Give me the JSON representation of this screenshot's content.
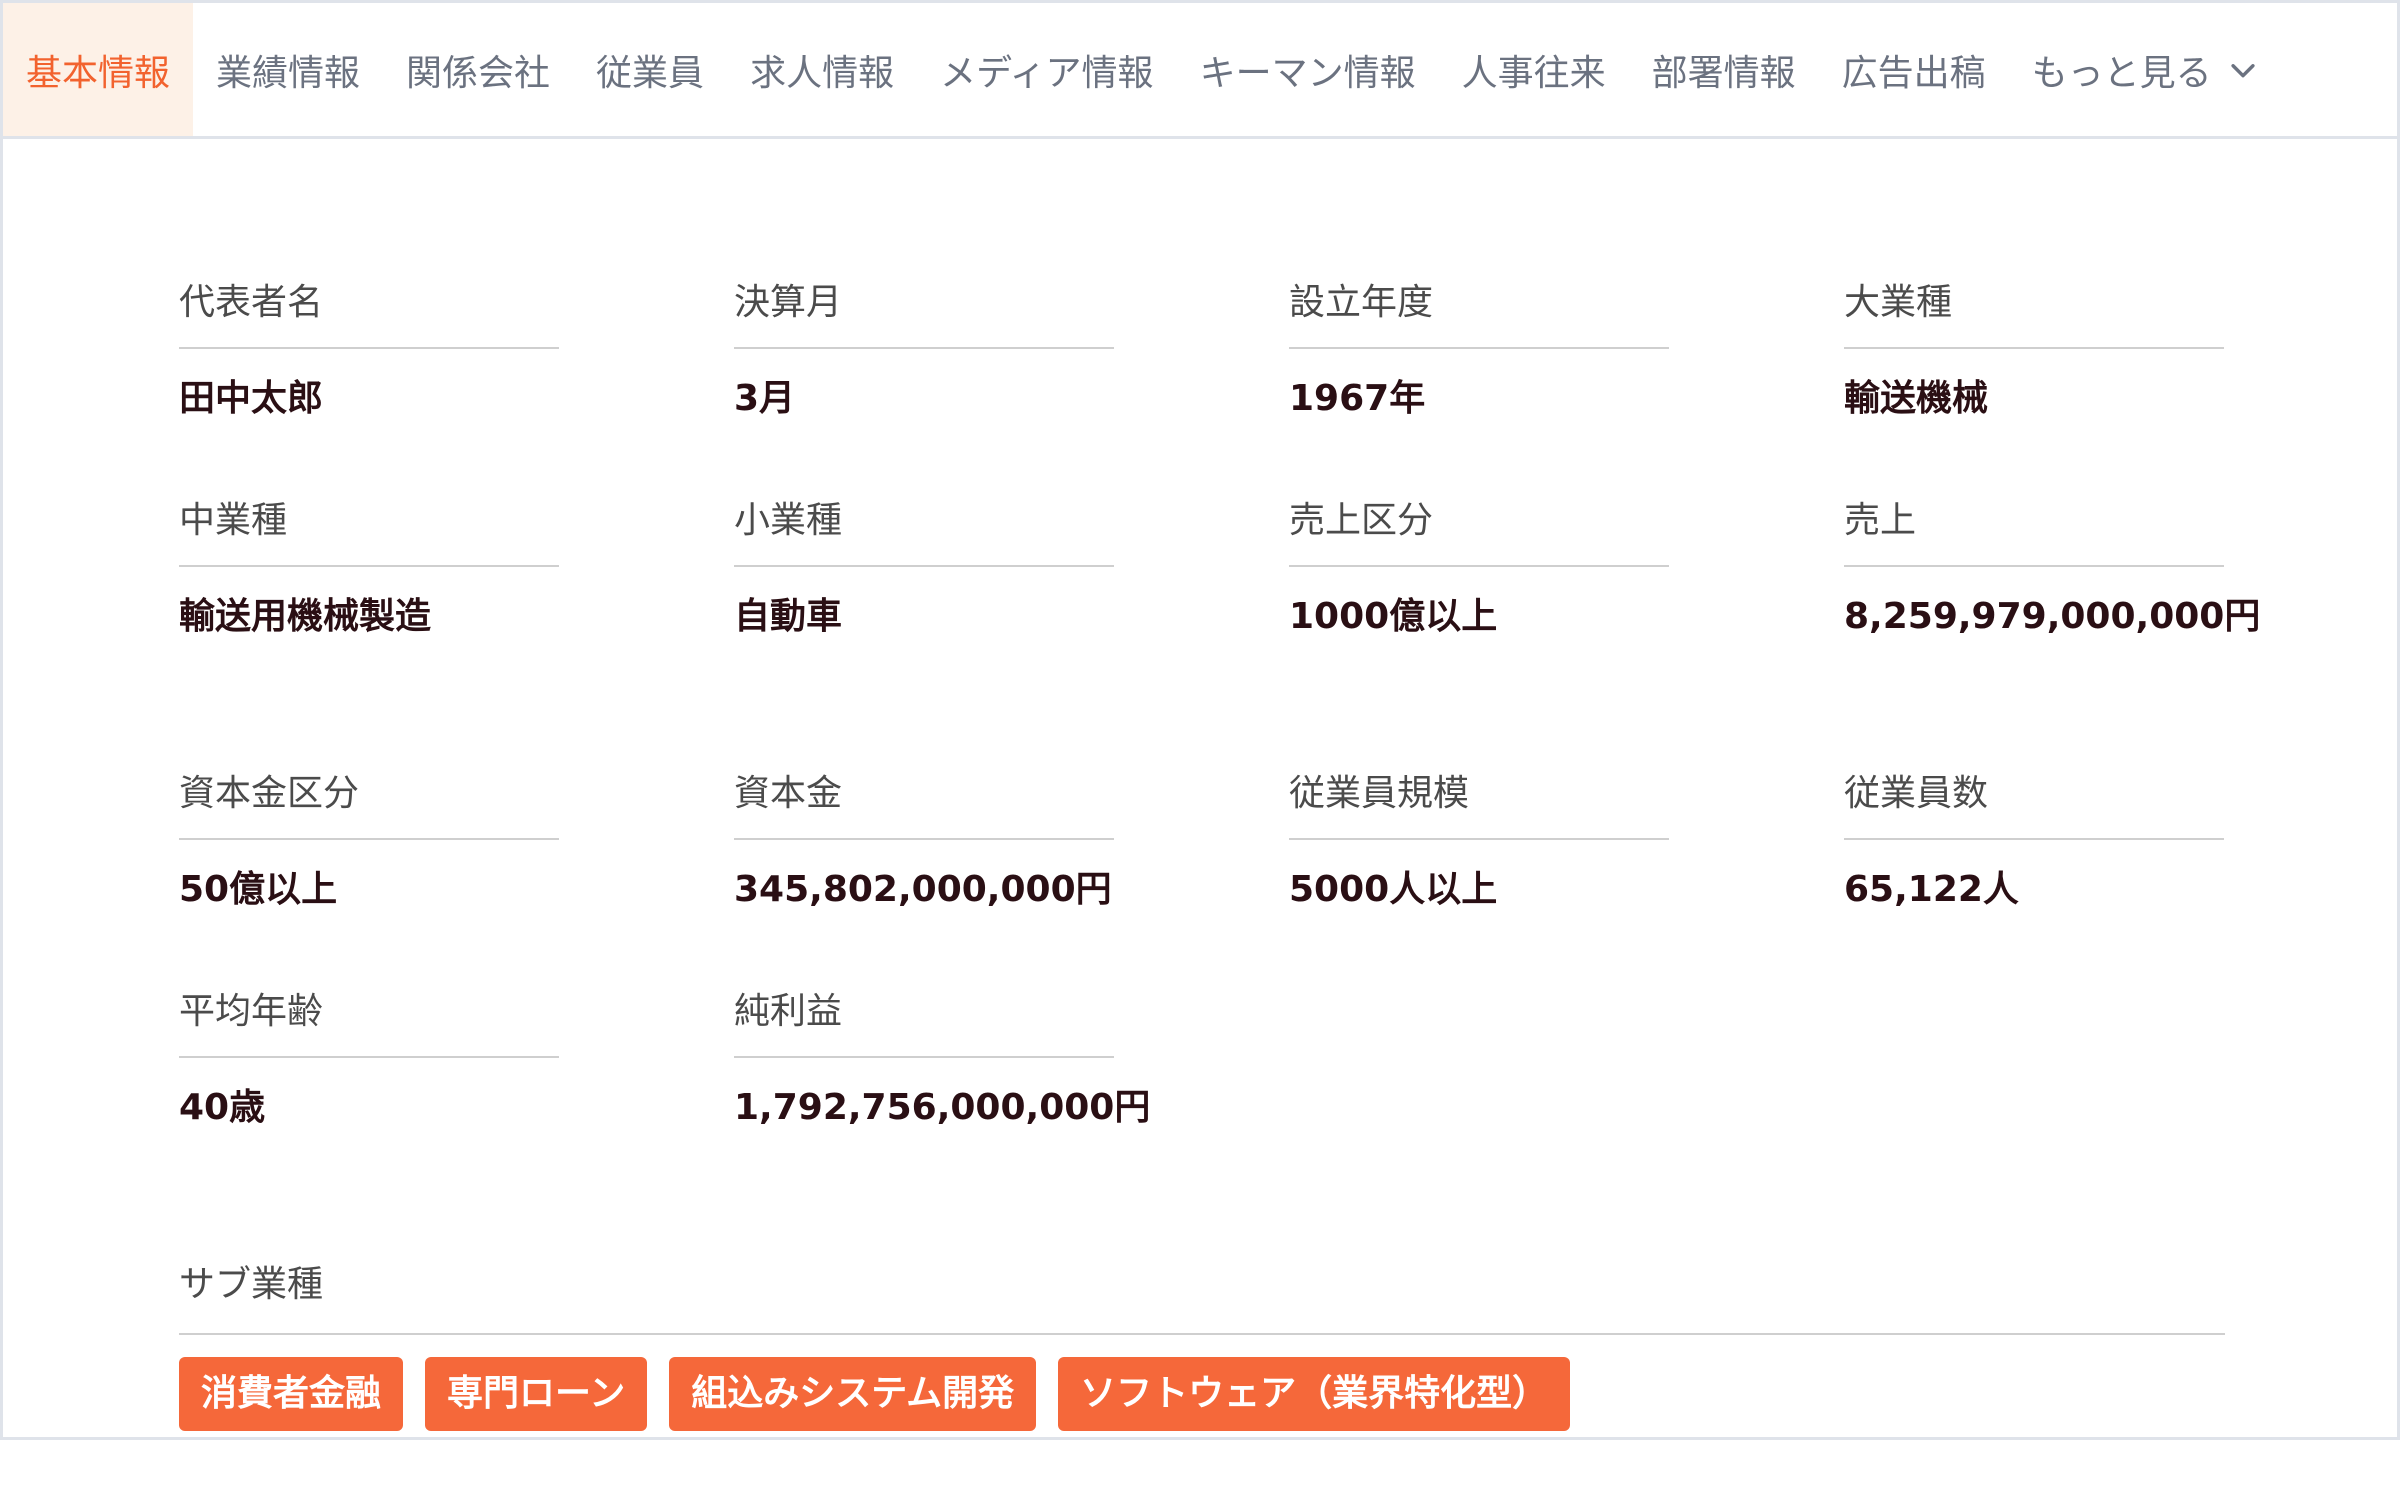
{
  "tabs": [
    {
      "label": "基本情報",
      "active": true
    },
    {
      "label": "業績情報"
    },
    {
      "label": "関係会社"
    },
    {
      "label": "従業員"
    },
    {
      "label": "求人情報"
    },
    {
      "label": "メディア情報"
    },
    {
      "label": "キーマン情報"
    },
    {
      "label": "人事往来"
    },
    {
      "label": "部署情報"
    },
    {
      "label": "広告出稿"
    }
  ],
  "more_tab": {
    "label": "もっと見る",
    "icon": "chevron-down-icon"
  },
  "colors": {
    "accent": "#f2622e",
    "chip_bg": "#f5683a",
    "active_tab_bg": "#fdf1e7"
  },
  "fields": [
    {
      "label": "代表者名",
      "value": "田中太郎"
    },
    {
      "label": "決算月",
      "value": "3月"
    },
    {
      "label": "設立年度",
      "value": "1967年"
    },
    {
      "label": "大業種",
      "value": "輸送機械"
    },
    {
      "label": "中業種",
      "value": "輸送用機械製造"
    },
    {
      "label": "小業種",
      "value": "自動車"
    },
    {
      "label": "売上区分",
      "value": "1000億以上"
    },
    {
      "label": "売上",
      "value": "8,259,979,000,000円"
    },
    {
      "label": "資本金区分",
      "value": "50億以上"
    },
    {
      "label": "資本金",
      "value": "345,802,000,000円"
    },
    {
      "label": "従業員規模",
      "value": "5000人以上"
    },
    {
      "label": "従業員数",
      "value": "65,122人"
    },
    {
      "label": "平均年齢",
      "value": "40歳"
    },
    {
      "label": "純利益",
      "value": "1,792,756,000,000円"
    }
  ],
  "sub_industry": {
    "label": "サブ業種",
    "tags": [
      "消費者金融",
      "専門ローン",
      "組込みシステム開発",
      "ソフトウェア（業界特化型）"
    ]
  }
}
